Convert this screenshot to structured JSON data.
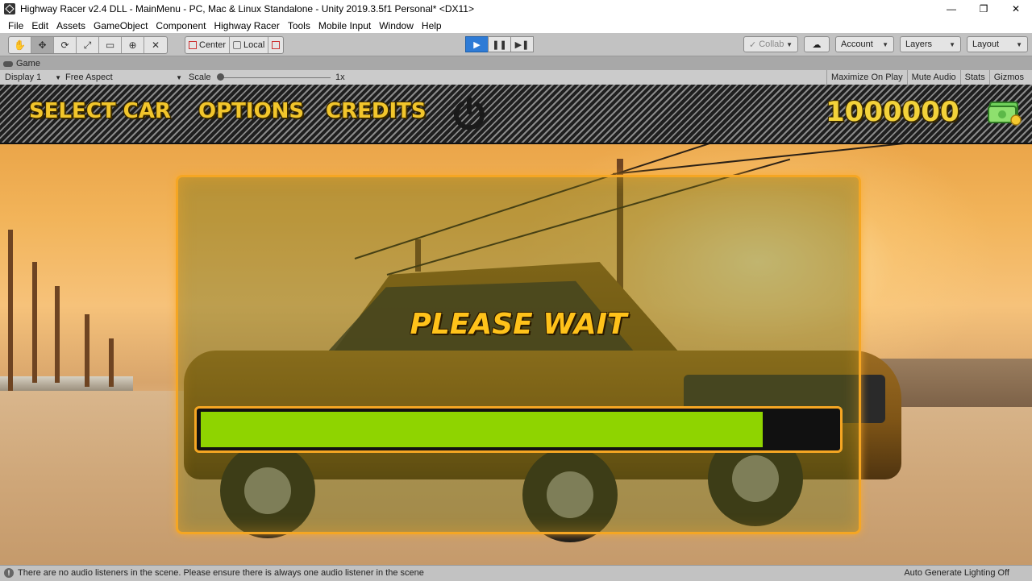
{
  "window": {
    "title": "Highway Racer v2.4 DLL - MainMenu - PC, Mac & Linux Standalone - Unity 2019.3.5f1 Personal* <DX11>",
    "controls": [
      "—",
      "❐",
      "✕"
    ]
  },
  "menu": [
    "File",
    "Edit",
    "Assets",
    "GameObject",
    "Component",
    "Highway Racer",
    "Tools",
    "Mobile Input",
    "Window",
    "Help"
  ],
  "toolbar": {
    "tools": [
      "✋",
      "✥",
      "⟳",
      "⤢",
      "▭",
      "⊕",
      "✕"
    ],
    "pivot_center": "Center",
    "pivot_local": "Local",
    "play": "▶",
    "pause": "❚❚",
    "step": "▶❚",
    "collab": "Collab",
    "account": "Account",
    "layers": "Layers",
    "layout": "Layout"
  },
  "game_tab": {
    "label": "Game"
  },
  "game_bar": {
    "display": "Display 1",
    "aspect": "Free Aspect",
    "scale_label": "Scale",
    "scale_value": "1x",
    "toggles": [
      "Maximize On Play",
      "Mute Audio",
      "Stats",
      "Gizmos"
    ]
  },
  "game": {
    "menu_buttons": [
      "SELECT CAR",
      "OPTIONS",
      "CREDITS"
    ],
    "money": "1000000",
    "loading_text": "PLEASE WAIT",
    "progress_fraction": 0.885
  },
  "status": {
    "message": "There are no audio listeners in the scene. Please ensure there is always one audio listener in the scene",
    "right": "Auto Generate Lighting Off"
  },
  "colors": {
    "accent_blue": "#2e7bd6",
    "game_yellow": "#f2c62c",
    "panel_orange": "#f5a623",
    "progress_green": "#8fd400"
  }
}
